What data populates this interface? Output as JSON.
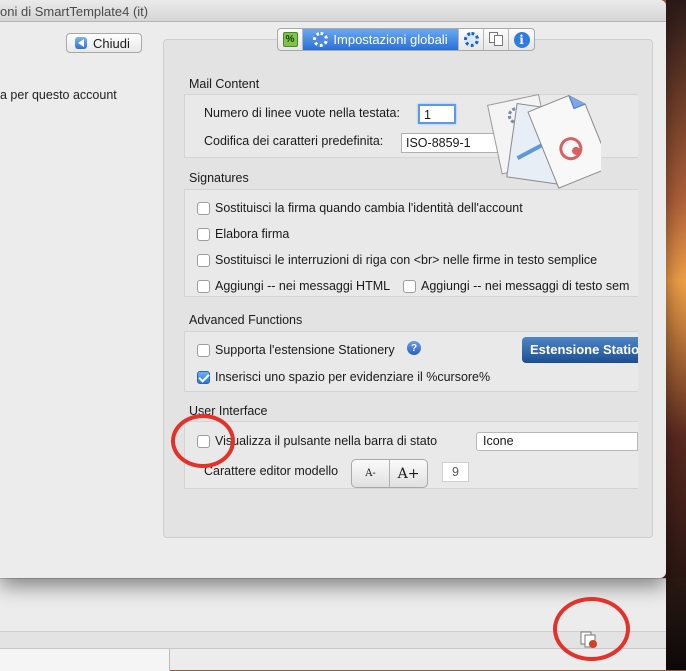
{
  "window": {
    "title": "oni di SmartTemplate4 (it)"
  },
  "left": {
    "close_label": "Chiudi",
    "account_text": "a per questo account"
  },
  "tabs": {
    "active_label": "Impostazioni globali",
    "icons": [
      "percent-icon",
      "gear-icon",
      "gear-icon",
      "multi-account-icon",
      "info-icon"
    ]
  },
  "mail_content": {
    "title": "Mail Content",
    "blank_lines_label": "Numero di linee vuote nella testata:",
    "blank_lines_value": "1",
    "charset_label": "Codifica dei caratteri predefinita:",
    "charset_value": "ISO-8859-1"
  },
  "signatures": {
    "title": "Signatures",
    "replace_on_identity_change": {
      "label": "Sostituisci la firma quando cambia l'identità dell'account",
      "checked": false
    },
    "process_signature": {
      "label": "Elabora firma",
      "checked": false
    },
    "replace_br": {
      "label": "Sostituisci le interruzioni di riga con <br> nelle firme in testo semplice",
      "checked": false
    },
    "add_dashes_html": {
      "label": "Aggiungi -- nei messaggi HTML",
      "checked": false
    },
    "add_dashes_plain": {
      "label": "Aggiungi -- nei messaggi di testo sem",
      "checked": false
    }
  },
  "advanced": {
    "title": "Advanced Functions",
    "stationery_support": {
      "label": "Supporta l'estensione Stationery",
      "checked": false
    },
    "help_glyph": "?",
    "stationery_button": "Estensione Station",
    "insert_space": {
      "label": "Inserisci uno spazio per evidenziare il %cursore%",
      "checked": true
    }
  },
  "ui": {
    "title": "User Interface",
    "show_status_button": {
      "label": "Visualizza il pulsante nella barra di stato",
      "checked": false
    },
    "status_display_value": "Icone",
    "editor_font_label": "Carattere editor modello",
    "font_smaller": "A-",
    "font_larger": "A+",
    "font_size_value": "9"
  },
  "colors": {
    "accent": "#2a6fd6",
    "annotation_circle": "#e2322a"
  }
}
